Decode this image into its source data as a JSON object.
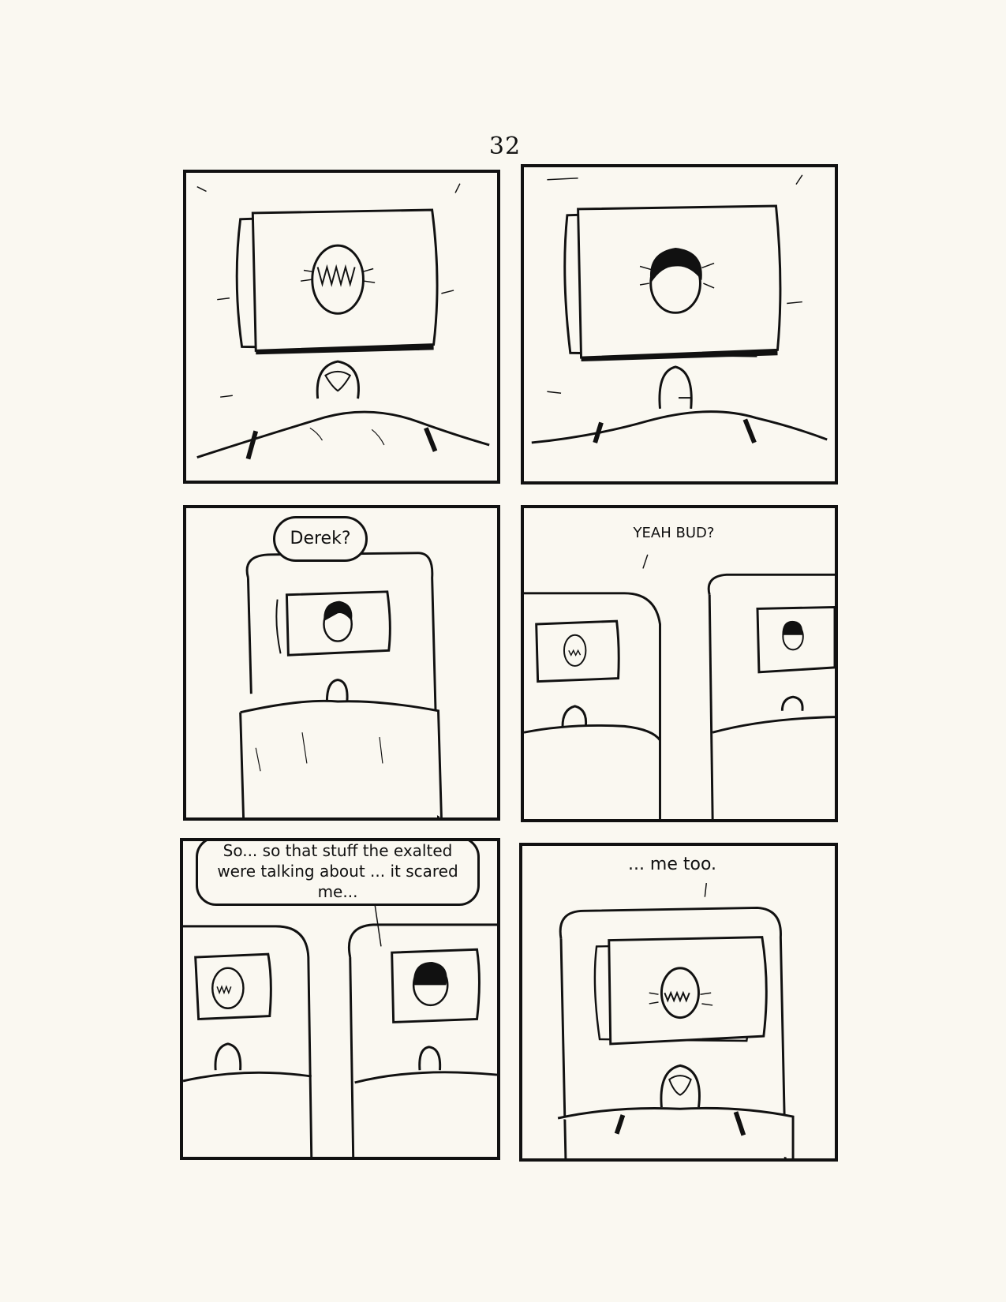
{
  "page": {
    "number": "32"
  },
  "panels": [
    {
      "id": 1,
      "speech": null
    },
    {
      "id": 2,
      "speech": null
    },
    {
      "id": 3,
      "speech": "Derek?"
    },
    {
      "id": 4,
      "speech": "YEAH BUD?"
    },
    {
      "id": 5,
      "speech": "So... so that stuff the exalted were talking about ... it scared me..."
    },
    {
      "id": 6,
      "speech": "... me too."
    }
  ],
  "colors": {
    "ink": "#111111",
    "paper": "#faf8f1"
  }
}
